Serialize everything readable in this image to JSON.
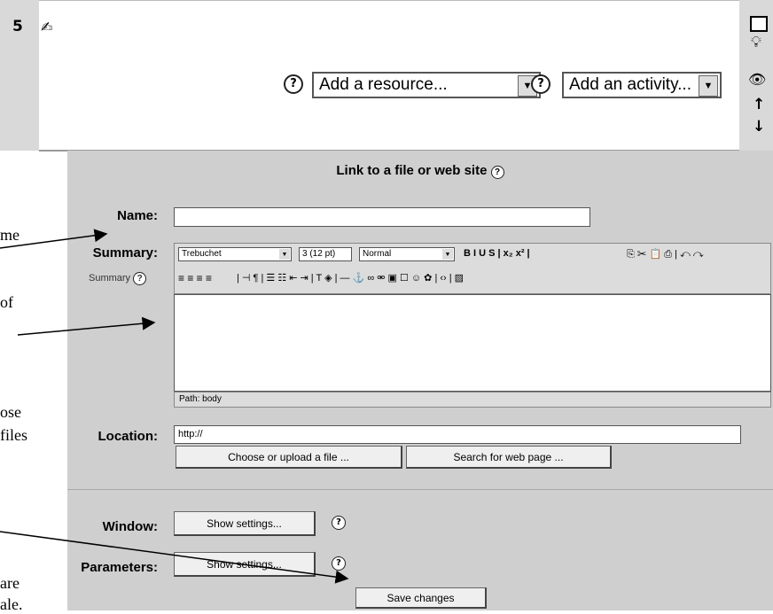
{
  "section": {
    "number": "5",
    "resource_select": "Add a resource...",
    "activity_select": "Add an activity...",
    "help_glyph": "?",
    "right_icons": [
      "square-icon",
      "lightbulb-icon",
      "eye-icon",
      "arrow-up-icon",
      "arrow-down-icon"
    ]
  },
  "form": {
    "heading": "Link to a file or web site",
    "name_label": "Name:",
    "summary_label": "Summary:",
    "summary_hint": "Summary",
    "toolbar": {
      "font": "Trebuchet",
      "size": "3 (12 pt)",
      "style": "Normal",
      "icons_row1": "B  I  U  S  |  x₂  x²  |",
      "icons_row2": "|  ⊣  ¶  |  ☰  ☷  ⇤  ⇥  |  T  ◈  |  —  ⚓  ∞  ⚮  ▣  ☐  ☺  ✿  |  ‹›  |  ▨"
    },
    "path_text": "Path: body",
    "location_label": "Location:",
    "location_value": "http://",
    "choose_button": "Choose or upload a file ...",
    "search_button": "Search for web page ...",
    "window_label": "Window:",
    "window_button": "Show settings...",
    "parameters_label": "Parameters:",
    "parameters_button": "Show settings...",
    "save_button": "Save changes"
  },
  "annotations": {
    "a1": "me",
    "a2": "of",
    "a3": "ose",
    "a4": "files",
    "a5": "are",
    "a6": "ale."
  }
}
